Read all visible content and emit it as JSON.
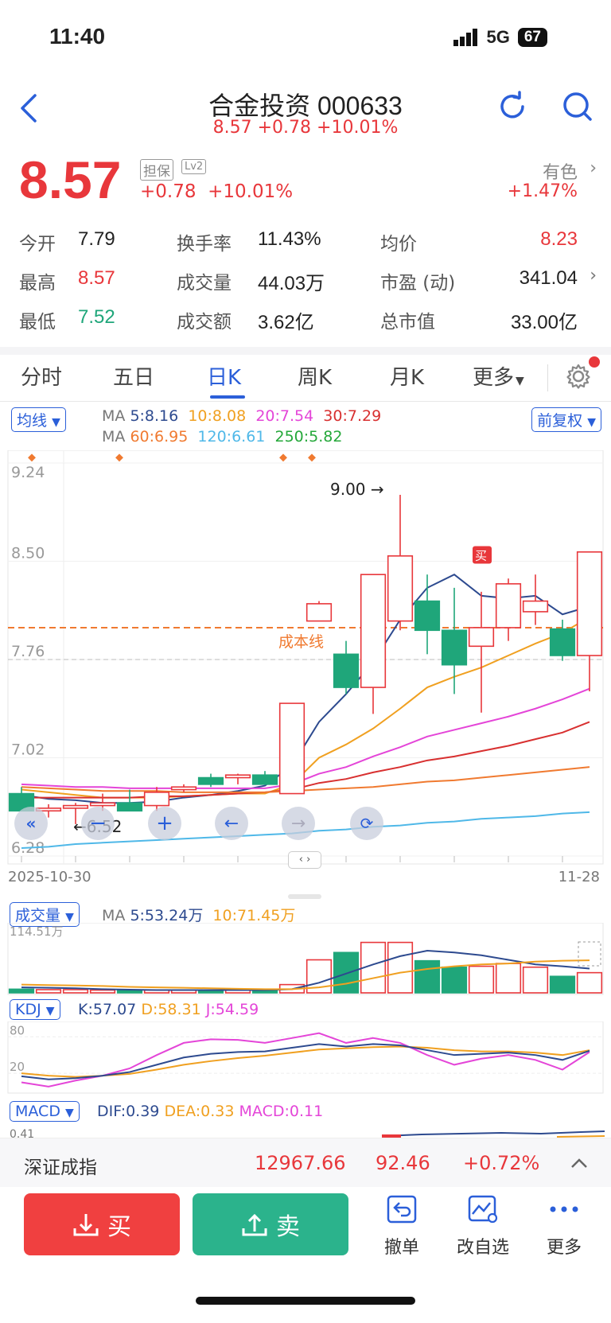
{
  "status": {
    "time": "11:40",
    "network": "5G",
    "battery": "67"
  },
  "header": {
    "title": "合金投资 000633",
    "subtitle": "8.57 +0.78 +10.01%"
  },
  "quote": {
    "price": "8.57",
    "badge_guarantee": "担保",
    "badge_lv": "Lv2",
    "change": "+0.78",
    "change_pct": "+10.01%",
    "sector_name": "有色",
    "sector_change": "+1.47%"
  },
  "stats": [
    {
      "label": "今开",
      "value": "7.79",
      "color": "#222"
    },
    {
      "label": "换手率",
      "value": "11.43%",
      "color": "#222"
    },
    {
      "label": "均价",
      "value": "8.23",
      "color": "#e8373b"
    },
    {
      "label": "最高",
      "value": "8.57",
      "color": "#e8373b"
    },
    {
      "label": "成交量",
      "value": "44.03万",
      "color": "#222"
    },
    {
      "label": "市盈 (动)",
      "value": "341.04",
      "color": "#222"
    },
    {
      "label": "最低",
      "value": "7.52",
      "color": "#1fa67a"
    },
    {
      "label": "成交额",
      "value": "3.62亿",
      "color": "#222"
    },
    {
      "label": "总市值",
      "value": "33.00亿",
      "color": "#222"
    }
  ],
  "tabs": [
    "分时",
    "五日",
    "日K",
    "周K",
    "月K",
    "更多"
  ],
  "chart_controls": {
    "ma_button": "均线",
    "adjust_button": "前复权",
    "ma_row1": {
      "prefix": "MA",
      "ma5": "5:8.16",
      "ma10": "10:8.08",
      "ma20": "20:7.54",
      "ma30": "30:7.29"
    },
    "ma_row2": {
      "prefix": "MA",
      "ma60": "60:6.95",
      "ma120": "120:6.61",
      "ma250": "250:5.82"
    }
  },
  "chart_data": {
    "type": "candlestick",
    "ylim": [
      6.28,
      9.24
    ],
    "y_ticks": [
      "9.24",
      "8.50",
      "7.76",
      "7.02",
      "6.28"
    ],
    "x_labels": [
      "2025-10-30",
      "11-28"
    ],
    "cost_line": {
      "value": 8.0,
      "label": "成本线"
    },
    "high_annotation": "9.00",
    "low_annotation": "6.52",
    "buy_marker": "买",
    "candles": [
      {
        "o": 6.75,
        "h": 6.8,
        "l": 6.62,
        "c": 6.62
      },
      {
        "o": 6.62,
        "h": 6.67,
        "l": 6.57,
        "c": 6.64
      },
      {
        "o": 6.64,
        "h": 6.68,
        "l": 6.52,
        "c": 6.66
      },
      {
        "o": 6.66,
        "h": 6.75,
        "l": 6.62,
        "c": 6.68
      },
      {
        "o": 6.68,
        "h": 6.78,
        "l": 6.62,
        "c": 6.62
      },
      {
        "o": 6.66,
        "h": 6.8,
        "l": 6.62,
        "c": 6.76
      },
      {
        "o": 6.78,
        "h": 6.82,
        "l": 6.76,
        "c": 6.8
      },
      {
        "o": 6.87,
        "h": 6.9,
        "l": 6.8,
        "c": 6.82
      },
      {
        "o": 6.87,
        "h": 6.9,
        "l": 6.82,
        "c": 6.89
      },
      {
        "o": 6.89,
        "h": 6.92,
        "l": 6.82,
        "c": 6.82
      },
      {
        "o": 6.75,
        "h": 7.43,
        "l": 6.75,
        "c": 7.43
      },
      {
        "o": 8.05,
        "h": 8.2,
        "l": 8.05,
        "c": 8.18
      },
      {
        "o": 7.8,
        "h": 7.9,
        "l": 7.5,
        "c": 7.55
      },
      {
        "o": 7.55,
        "h": 8.4,
        "l": 7.35,
        "c": 8.4
      },
      {
        "o": 8.05,
        "h": 9.0,
        "l": 7.98,
        "c": 8.54
      },
      {
        "o": 8.2,
        "h": 8.4,
        "l": 7.8,
        "c": 7.98
      },
      {
        "o": 7.98,
        "h": 8.3,
        "l": 7.5,
        "c": 7.72
      },
      {
        "o": 7.86,
        "h": 8.27,
        "l": 7.36,
        "c": 8.0
      },
      {
        "o": 8.0,
        "h": 8.37,
        "l": 7.9,
        "c": 8.33
      },
      {
        "o": 8.12,
        "h": 8.4,
        "l": 8.02,
        "c": 8.2
      },
      {
        "o": 7.99,
        "h": 8.06,
        "l": 7.75,
        "c": 7.79
      },
      {
        "o": 7.79,
        "h": 8.57,
        "l": 7.52,
        "c": 8.57
      }
    ],
    "ma_series": [
      {
        "name": "MA5",
        "color": "#2d4a8f",
        "values": [
          6.74,
          6.71,
          6.7,
          6.68,
          6.68,
          6.69,
          6.72,
          6.74,
          6.77,
          6.81,
          6.96,
          7.29,
          7.5,
          7.74,
          8.06,
          8.3,
          8.4,
          8.24,
          8.22,
          8.24,
          8.1,
          8.16
        ]
      },
      {
        "name": "MA10",
        "color": "#f0a020",
        "values": [
          6.78,
          6.76,
          6.74,
          6.72,
          6.72,
          6.72,
          6.73,
          6.74,
          6.75,
          6.75,
          6.82,
          7.02,
          7.12,
          7.24,
          7.39,
          7.55,
          7.63,
          7.7,
          7.79,
          7.88,
          7.96,
          8.08
        ]
      },
      {
        "name": "MA20",
        "color": "#e445d8",
        "values": [
          6.82,
          6.81,
          6.8,
          6.8,
          6.79,
          6.79,
          6.79,
          6.79,
          6.79,
          6.79,
          6.82,
          6.9,
          6.95,
          7.03,
          7.1,
          7.18,
          7.23,
          7.28,
          7.33,
          7.39,
          7.46,
          7.54
        ]
      },
      {
        "name": "MA30",
        "color": "#d83030",
        "values": [
          6.72,
          6.72,
          6.72,
          6.72,
          6.72,
          6.73,
          6.73,
          6.74,
          6.75,
          6.76,
          6.78,
          6.83,
          6.86,
          6.91,
          6.95,
          7.0,
          7.03,
          7.07,
          7.11,
          7.16,
          7.21,
          7.29
        ]
      },
      {
        "name": "MA60",
        "color": "#f07a30",
        "values": [
          6.8,
          6.79,
          6.78,
          6.77,
          6.77,
          6.77,
          6.76,
          6.76,
          6.76,
          6.76,
          6.77,
          6.78,
          6.79,
          6.8,
          6.82,
          6.84,
          6.85,
          6.87,
          6.89,
          6.91,
          6.93,
          6.95
        ]
      },
      {
        "name": "MA120",
        "color": "#4fb8e8",
        "values": [
          6.34,
          6.35,
          6.37,
          6.38,
          6.39,
          6.4,
          6.41,
          6.42,
          6.43,
          6.44,
          6.45,
          6.47,
          6.48,
          6.5,
          6.51,
          6.53,
          6.54,
          6.56,
          6.57,
          6.58,
          6.6,
          6.61
        ]
      }
    ],
    "volume": {
      "button": "成交量",
      "prefix": "MA",
      "ma5": "5:53.24万",
      "ma10": "10:71.45万",
      "max_label": "114.51万",
      "max": 114.51,
      "bars": [
        8,
        7,
        7,
        6,
        6,
        6,
        6,
        6,
        6,
        6,
        18,
        72,
        88,
        110,
        110,
        70,
        56,
        58,
        64,
        56,
        36,
        44
      ],
      "ma5_line": [
        12,
        11,
        10,
        8,
        7,
        6,
        6,
        6,
        6,
        6,
        8,
        22,
        42,
        62,
        80,
        92,
        88,
        82,
        72,
        62,
        58,
        53
      ],
      "ma10_line": [
        18,
        17,
        16,
        15,
        13,
        12,
        11,
        10,
        9,
        8,
        8,
        12,
        20,
        32,
        44,
        52,
        58,
        62,
        64,
        68,
        70,
        71
      ]
    },
    "kdj": {
      "button": "KDJ",
      "k": "K:57.07",
      "d": "D:58.31",
      "j": "J:54.59",
      "ticks": [
        "80",
        "20"
      ],
      "K": [
        15,
        10,
        12,
        16,
        22,
        34,
        46,
        52,
        55,
        56,
        62,
        68,
        64,
        68,
        66,
        58,
        50,
        52,
        54,
        50,
        42,
        57
      ],
      "D": [
        20,
        16,
        14,
        16,
        19,
        26,
        34,
        40,
        45,
        49,
        54,
        59,
        61,
        63,
        64,
        62,
        58,
        56,
        56,
        54,
        50,
        58
      ],
      "J": [
        5,
        -2,
        8,
        16,
        28,
        50,
        70,
        76,
        75,
        70,
        78,
        86,
        70,
        78,
        70,
        50,
        34,
        44,
        50,
        42,
        26,
        55
      ]
    },
    "macd": {
      "button": "MACD",
      "dif": "DIF:0.39",
      "dea": "DEA:0.33",
      "macd": "MACD:0.11",
      "tick": "0.41"
    }
  },
  "index_bar": {
    "name": "深证成指",
    "value": "12967.66",
    "change": "92.46",
    "change_pct": "+0.72%"
  },
  "bottom": {
    "buy": "买",
    "sell": "卖",
    "cancel": "撤单",
    "watchlist": "改自选",
    "more": "更多"
  }
}
